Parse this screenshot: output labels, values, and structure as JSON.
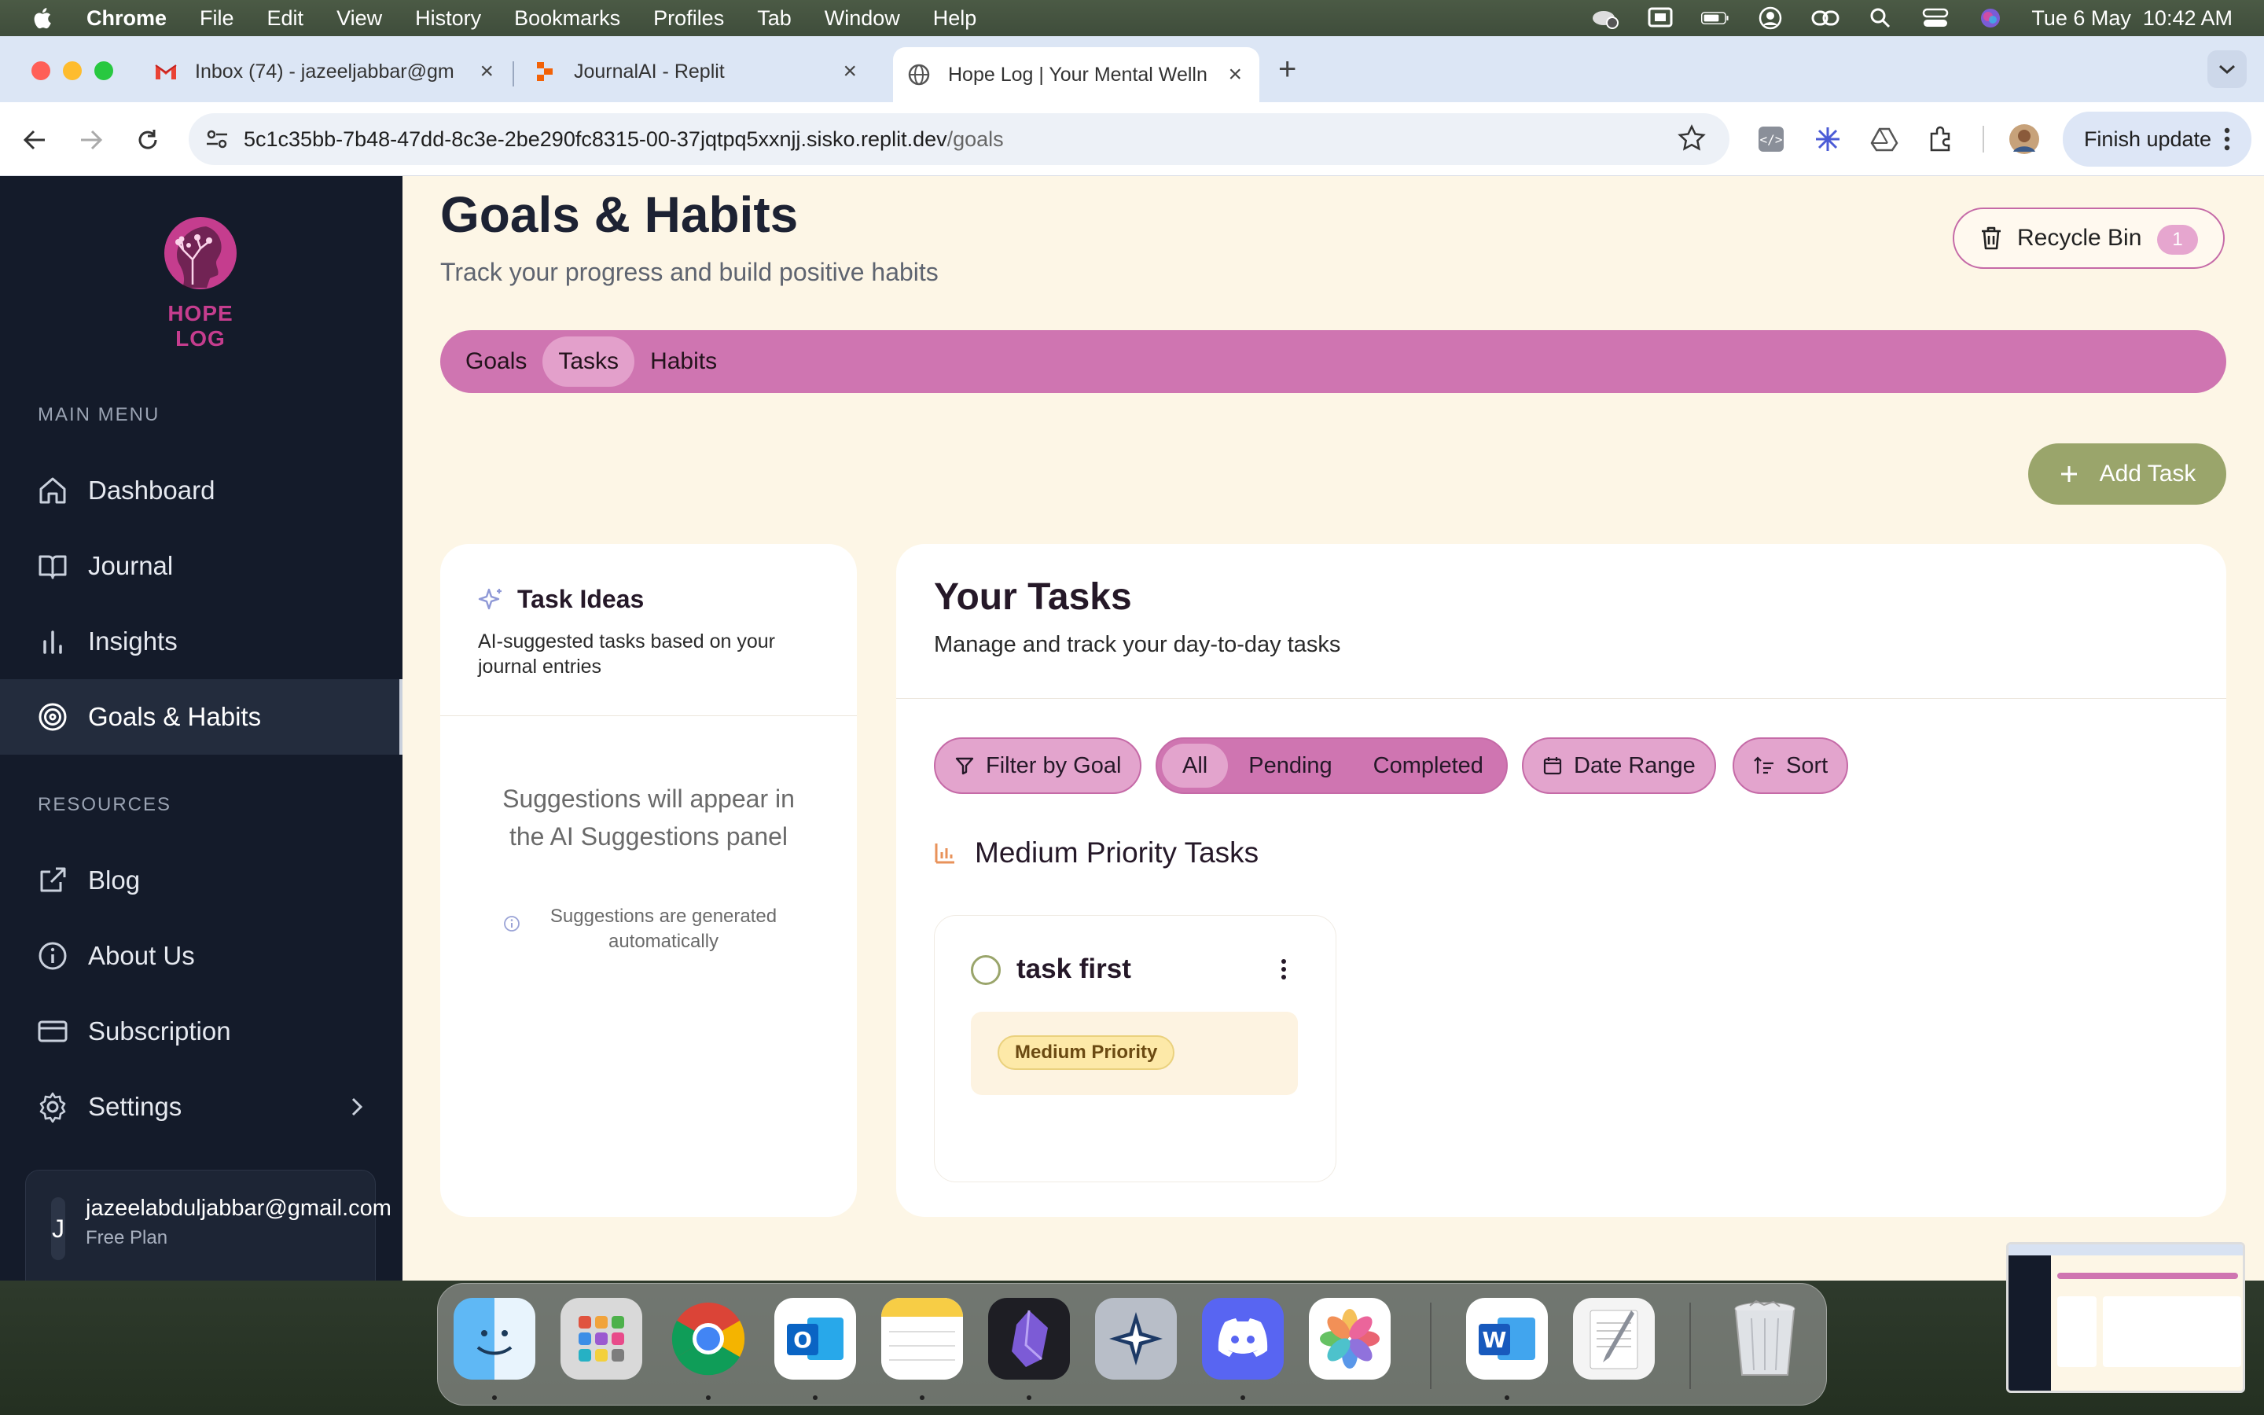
{
  "menubar": {
    "app_name": "Chrome",
    "menus": [
      "File",
      "Edit",
      "View",
      "History",
      "Bookmarks",
      "Profiles",
      "Tab",
      "Window",
      "Help"
    ],
    "datetime": "Tue 6 May  10:42 AM"
  },
  "browser": {
    "tabs": [
      {
        "title": "Inbox (74) - jazeeljabbar@gm",
        "icon": "gmail-icon"
      },
      {
        "title": "JournalAI - Replit",
        "icon": "replit-icon"
      },
      {
        "title": "Hope Log | Your Mental Welln",
        "icon": "globe-icon",
        "active": true
      }
    ],
    "url_host": "5c1c35bb-7b48-47dd-8c3e-2be290fc8315-00-37jqtpq5xxnjj.sisko.replit.dev",
    "url_path": "/goals",
    "finish_update_label": "Finish update"
  },
  "sidebar": {
    "brand": "HOPE LOG",
    "main_menu_label": "MAIN MENU",
    "main_items": [
      {
        "label": "Dashboard",
        "icon": "home-icon"
      },
      {
        "label": "Journal",
        "icon": "book-icon"
      },
      {
        "label": "Insights",
        "icon": "bar-chart-icon"
      },
      {
        "label": "Goals & Habits",
        "icon": "target-icon",
        "active": true
      }
    ],
    "resources_label": "RESOURCES",
    "resource_items": [
      {
        "label": "Blog",
        "icon": "external-link-icon"
      },
      {
        "label": "About Us",
        "icon": "info-icon"
      },
      {
        "label": "Subscription",
        "icon": "credit-card-icon"
      },
      {
        "label": "Settings",
        "icon": "gear-icon"
      }
    ],
    "user": {
      "initial": "J",
      "email": "jazeelabduljabbar@gmail.com",
      "plan": "Free Plan"
    }
  },
  "header": {
    "title": "Goals & Habits",
    "subtitle": "Track your progress and build positive habits",
    "recycle_bin_label": "Recycle Bin",
    "recycle_bin_count": "1"
  },
  "section_tabs": [
    {
      "label": "Goals"
    },
    {
      "label": "Tasks",
      "active": true
    },
    {
      "label": "Habits"
    }
  ],
  "add_task_label": "Add Task",
  "task_ideas": {
    "title": "Task Ideas",
    "description": "AI-suggested tasks based on your journal entries",
    "empty_message": "Suggestions will appear in the AI Suggestions panel",
    "auto_note": "Suggestions are generated automatically"
  },
  "tasks_panel": {
    "title": "Your Tasks",
    "subtitle": "Manage and track your day-to-day tasks",
    "filter_by_goal_label": "Filter by Goal",
    "status_filters": [
      {
        "label": "All",
        "active": true
      },
      {
        "label": "Pending"
      },
      {
        "label": "Completed"
      }
    ],
    "date_range_label": "Date Range",
    "sort_label": "Sort",
    "group_title": "Medium Priority Tasks",
    "tasks": [
      {
        "name": "task first",
        "priority": "Medium Priority",
        "completed": false
      }
    ]
  },
  "colors": {
    "sidebar_bg": "#141b2a",
    "page_bg": "#fdf6e6",
    "accent_pink": "#cf75b1",
    "accent_olive": "#9aa56b",
    "brand_magenta": "#c53d8e"
  },
  "dock": {
    "apps": [
      "finder-icon",
      "launchpad-icon",
      "chrome-icon",
      "outlook-icon",
      "notes-icon",
      "obsidian-icon",
      "perplexity-icon",
      "discord-icon",
      "photos-icon",
      "word-icon",
      "textedit-icon",
      "trash-icon"
    ]
  }
}
